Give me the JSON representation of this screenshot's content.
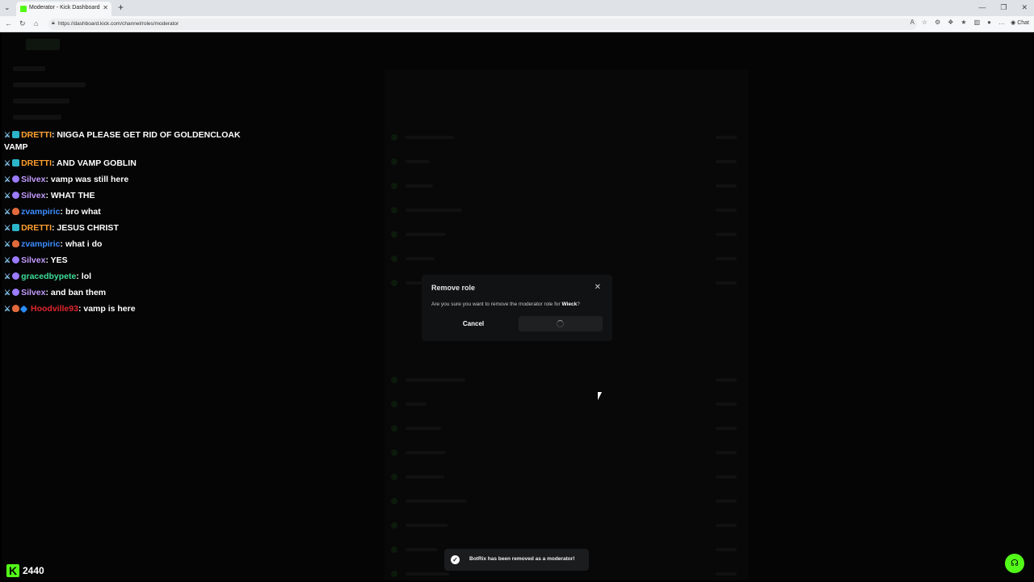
{
  "browser": {
    "tab_title": "Moderator - Kick Dashboard",
    "url": "https://dashboard.kick.com/channel/roles/moderator",
    "chat_button_label": "Chat"
  },
  "chat": {
    "lines": [
      {
        "user": "DRETTI",
        "color": "#ff9f2e",
        "message": "NIGGA PLEASE GET RID OF GOLDENCLOAK VAMP"
      },
      {
        "user": "DRETTI",
        "color": "#ff9f2e",
        "message": "AND VAMP GOBLIN"
      },
      {
        "user": "Silvex",
        "color": "#c59bff",
        "message": "vamp was still here"
      },
      {
        "user": "Silvex",
        "color": "#c59bff",
        "message": "WHAT THE"
      },
      {
        "user": "zvampiric",
        "color": "#3c8dff",
        "message": "bro what"
      },
      {
        "user": "DRETTI",
        "color": "#ff9f2e",
        "message": "JESUS CHRIST"
      },
      {
        "user": "zvampiric",
        "color": "#3c8dff",
        "message": "what i do"
      },
      {
        "user": "Silvex",
        "color": "#c59bff",
        "message": "YES"
      },
      {
        "user": "gracedbypete",
        "color": "#3ddc97",
        "message": "lol"
      },
      {
        "user": "Silvex",
        "color": "#c59bff",
        "message": "and ban them"
      },
      {
        "user": "Hoodville93",
        "color": "#e0262e",
        "message": "vamp is here"
      }
    ],
    "viewer_count": "2440"
  },
  "modal": {
    "title": "Remove role",
    "body_prefix": "Are you sure you want to remove the moderator role for ",
    "body_user": "Wieck",
    "body_suffix": "?",
    "cancel_label": "Cancel"
  },
  "toast": {
    "message": "BotRix has been removed as a moderator!"
  },
  "colors": {
    "brand": "#53fc18"
  }
}
